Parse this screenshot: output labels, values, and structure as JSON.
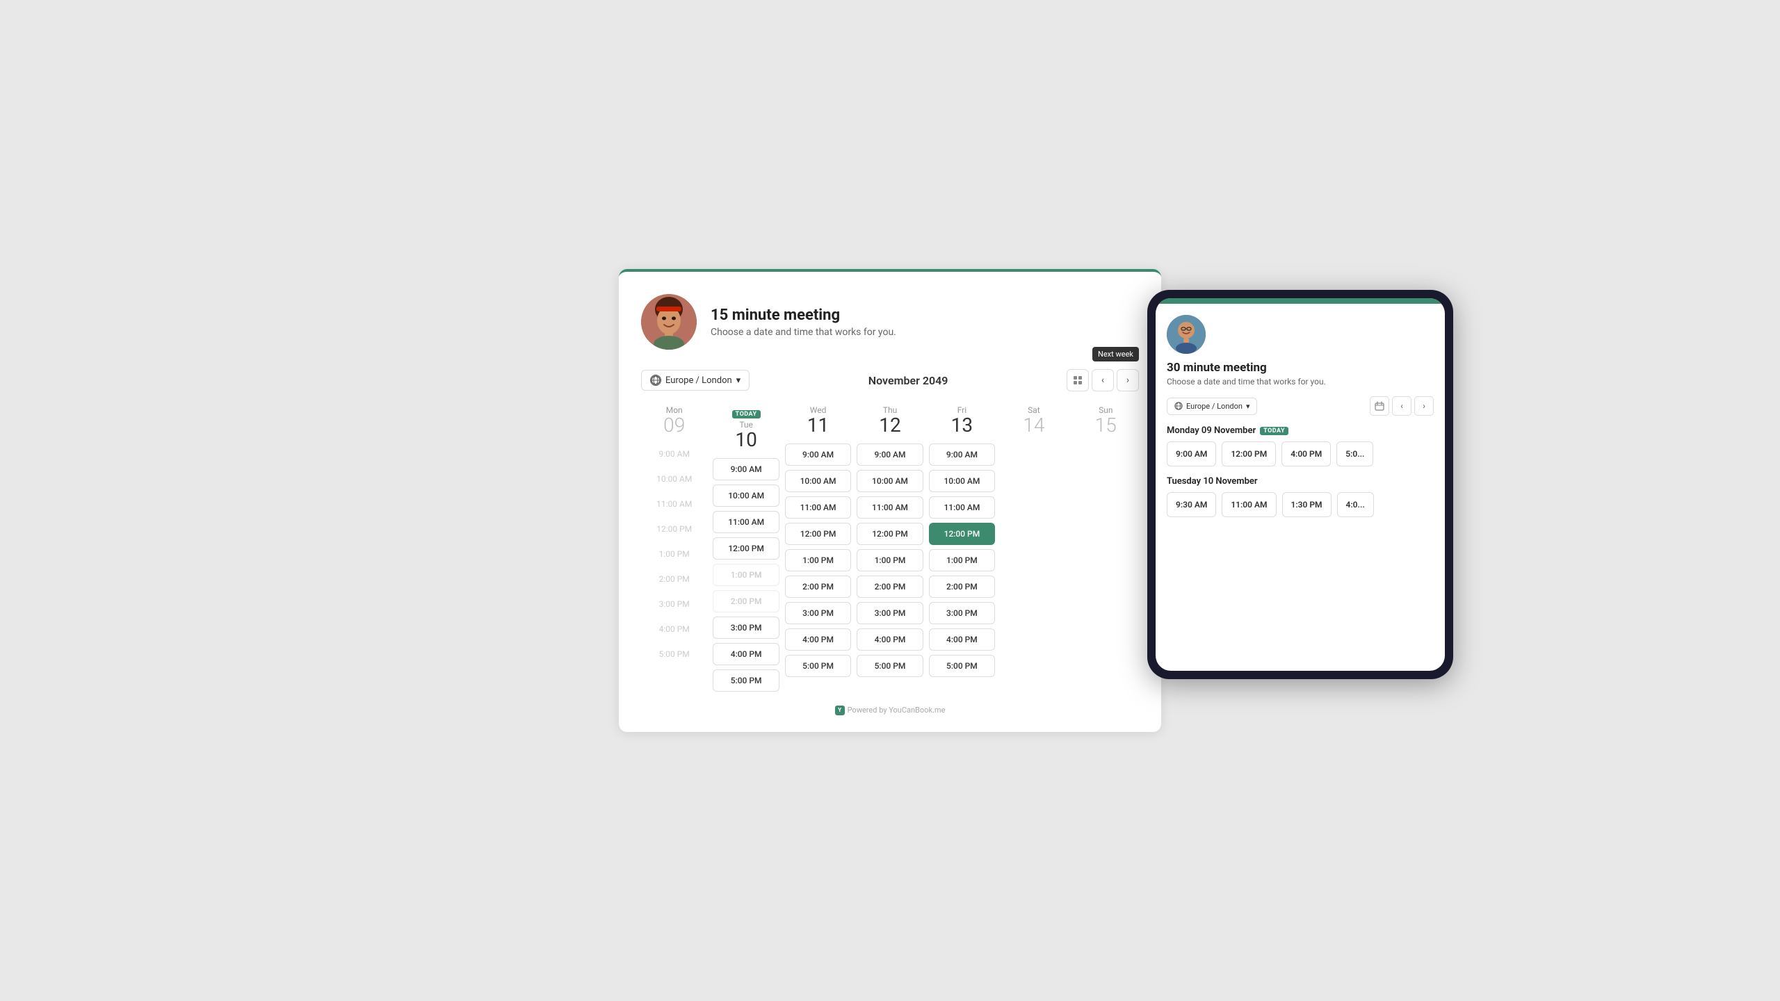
{
  "app": {
    "brand_color": "#3d8b6e",
    "powered_by": "Powered by YouCanBook.me"
  },
  "main_card": {
    "title": "15 minute meeting",
    "subtitle": "Choose a date and time that works for you.",
    "timezone": "Europe / London",
    "month_title": "November 2049",
    "today_label": "TODAY",
    "next_week_tooltip": "Next week"
  },
  "days": [
    {
      "name": "Mon",
      "number": "09",
      "active": false,
      "today": false,
      "slots": [
        {
          "time": "9:00 AM",
          "state": "ghost"
        },
        {
          "time": "10:00 AM",
          "state": "ghost"
        },
        {
          "time": "11:00 AM",
          "state": "ghost"
        },
        {
          "time": "12:00 PM",
          "state": "ghost"
        },
        {
          "time": "1:00 PM",
          "state": "ghost"
        },
        {
          "time": "2:00 PM",
          "state": "ghost"
        },
        {
          "time": "3:00 PM",
          "state": "ghost"
        },
        {
          "time": "4:00 PM",
          "state": "ghost"
        },
        {
          "time": "5:00 PM",
          "state": "ghost"
        }
      ]
    },
    {
      "name": "Tue",
      "number": "10",
      "active": true,
      "today": true,
      "slots": [
        {
          "time": "9:00 AM",
          "state": "normal"
        },
        {
          "time": "10:00 AM",
          "state": "normal"
        },
        {
          "time": "11:00 AM",
          "state": "normal"
        },
        {
          "time": "12:00 PM",
          "state": "normal"
        },
        {
          "time": "1:00 PM",
          "state": "disabled"
        },
        {
          "time": "2:00 PM",
          "state": "disabled"
        },
        {
          "time": "3:00 PM",
          "state": "normal"
        },
        {
          "time": "4:00 PM",
          "state": "normal"
        },
        {
          "time": "5:00 PM",
          "state": "normal"
        }
      ]
    },
    {
      "name": "Wed",
      "number": "11",
      "active": true,
      "today": false,
      "slots": [
        {
          "time": "9:00 AM",
          "state": "normal"
        },
        {
          "time": "10:00 AM",
          "state": "normal"
        },
        {
          "time": "11:00 AM",
          "state": "normal"
        },
        {
          "time": "12:00 PM",
          "state": "normal"
        },
        {
          "time": "1:00 PM",
          "state": "normal"
        },
        {
          "time": "2:00 PM",
          "state": "normal"
        },
        {
          "time": "3:00 PM",
          "state": "normal"
        },
        {
          "time": "4:00 PM",
          "state": "normal"
        },
        {
          "time": "5:00 PM",
          "state": "normal"
        }
      ]
    },
    {
      "name": "Thu",
      "number": "12",
      "active": true,
      "today": false,
      "slots": [
        {
          "time": "9:00 AM",
          "state": "normal"
        },
        {
          "time": "10:00 AM",
          "state": "normal"
        },
        {
          "time": "11:00 AM",
          "state": "normal"
        },
        {
          "time": "12:00 PM",
          "state": "normal"
        },
        {
          "time": "1:00 PM",
          "state": "normal"
        },
        {
          "time": "2:00 PM",
          "state": "normal"
        },
        {
          "time": "3:00 PM",
          "state": "normal"
        },
        {
          "time": "4:00 PM",
          "state": "normal"
        },
        {
          "time": "5:00 PM",
          "state": "normal"
        }
      ]
    },
    {
      "name": "Fri",
      "number": "13",
      "active": true,
      "today": false,
      "slots": [
        {
          "time": "9:00 AM",
          "state": "normal"
        },
        {
          "time": "10:00 AM",
          "state": "normal"
        },
        {
          "time": "11:00 AM",
          "state": "normal"
        },
        {
          "time": "12:00 PM",
          "state": "selected"
        },
        {
          "time": "1:00 PM",
          "state": "normal"
        },
        {
          "time": "2:00 PM",
          "state": "normal"
        },
        {
          "time": "3:00 PM",
          "state": "normal"
        },
        {
          "time": "4:00 PM",
          "state": "normal"
        },
        {
          "time": "5:00 PM",
          "state": "normal"
        }
      ]
    },
    {
      "name": "Sat",
      "number": "14",
      "active": false,
      "today": false,
      "slots": []
    },
    {
      "name": "Sun",
      "number": "15",
      "active": false,
      "today": false,
      "slots": []
    }
  ],
  "mobile": {
    "title": "30 minute meeting",
    "subtitle": "Choose a date and time that works for you.",
    "timezone": "Europe / London",
    "days": [
      {
        "label": "Monday 09 November",
        "today": true,
        "slots": [
          "9:00 AM",
          "12:00 PM",
          "4:00 PM",
          "5:0..."
        ]
      },
      {
        "label": "Tuesday 10 November",
        "today": false,
        "slots": [
          "9:30 AM",
          "11:00 AM",
          "1:30 PM",
          "4:0..."
        ]
      }
    ]
  }
}
